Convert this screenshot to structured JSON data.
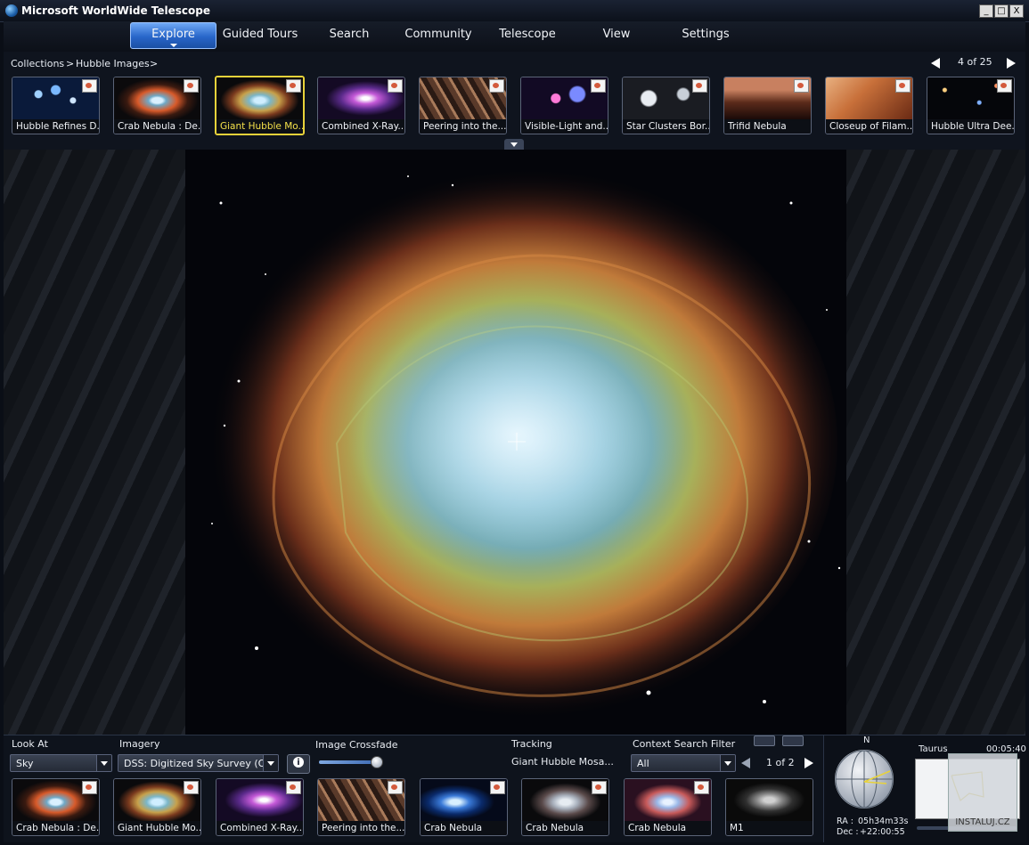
{
  "window": {
    "title": "Microsoft WorldWide Telescope",
    "min_label": "_",
    "max_label": "□",
    "close_label": "X"
  },
  "menu": {
    "items": [
      "Explore",
      "Guided Tours",
      "Search",
      "Community",
      "Telescope",
      "View",
      "Settings"
    ],
    "active_index": 0
  },
  "breadcrumb": {
    "items": [
      "Collections",
      ">",
      "Hubble Images",
      ">"
    ]
  },
  "pager": {
    "label": "4 of 25"
  },
  "collection": {
    "thumbnails": [
      "Hubble Refines D...",
      "Crab Nebula : De...",
      "Giant Hubble Mo...",
      "Combined X-Ray...",
      "Peering into the...",
      "Visible-Light and...",
      "Star Clusters Bor...",
      "Trifid Nebula",
      "Closeup of Filam...",
      "Hubble Ultra Dee..."
    ],
    "selected_index": 2
  },
  "viewer": {
    "image": "Crab Nebula mosaic (Hubble)"
  },
  "bottom": {
    "look_at": {
      "label": "Look At",
      "value": "Sky"
    },
    "imagery": {
      "label": "Imagery",
      "value": "DSS: Digitized Sky Survey (O..."
    },
    "crossfade": {
      "label": "Image Crossfade",
      "level": 0.9
    },
    "tracking": {
      "label": "Tracking",
      "value": "Giant Hubble Mosa..."
    },
    "context_filter": {
      "label": "Context Search Filter",
      "value": "All"
    },
    "context_pager": "1 of 2",
    "context_thumbnails": [
      "Crab Nebula : De...",
      "Giant Hubble Mo...",
      "Combined X-Ray...",
      "Peering into the...",
      "Crab Nebula",
      "Crab Nebula",
      "Crab Nebula",
      "M1"
    ]
  },
  "navigator": {
    "north": "N",
    "constellation": "Taurus",
    "time": "00:05:40",
    "ra_label": "RA :",
    "ra": "05h34m33s",
    "dec_label": "Dec :",
    "dec": "+22:00:55",
    "watermark": "INSTALUJ.CZ"
  },
  "colors": {
    "accent": "#2f6fd6",
    "selected": "#e8d23a"
  }
}
